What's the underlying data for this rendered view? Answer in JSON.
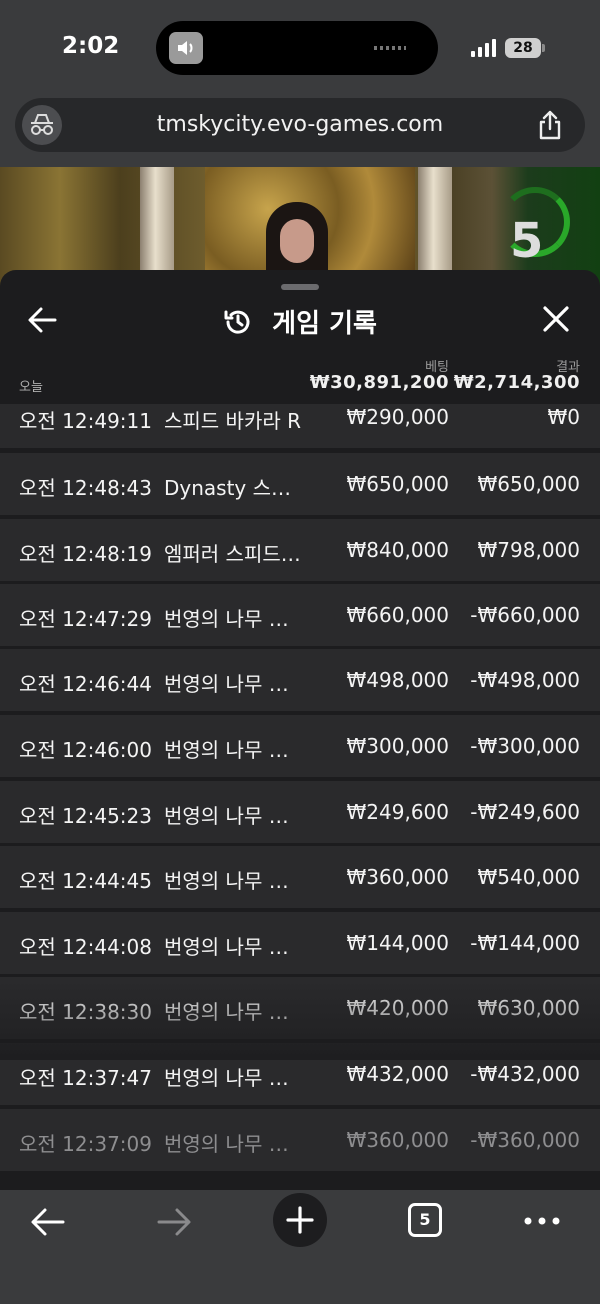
{
  "status_bar": {
    "time": "2:02",
    "battery": "28"
  },
  "browser": {
    "url": "tmskycity.evo-games.com",
    "tab_count": "5"
  },
  "video": {
    "timer": "5"
  },
  "panel": {
    "title": "게임 기록",
    "section_label": "오늘",
    "bet_header": "베팅",
    "result_header": "결과",
    "bet_total": "₩30,891,200",
    "result_total": "₩2,714,300",
    "rows": [
      {
        "time": "오전 12:49:11",
        "game": "스피드 바카라 R",
        "bet": "₩290,000",
        "result": "₩0"
      },
      {
        "time": "오전 12:48:43",
        "game": "Dynasty 스피...",
        "bet": "₩650,000",
        "result": "₩650,000"
      },
      {
        "time": "오전 12:48:19",
        "game": "엠퍼러 스피드 ...",
        "bet": "₩840,000",
        "result": "₩798,000"
      },
      {
        "time": "오전 12:47:29",
        "game": "번영의 나무 바...",
        "bet": "₩660,000",
        "result": "-₩660,000"
      },
      {
        "time": "오전 12:46:44",
        "game": "번영의 나무 바...",
        "bet": "₩498,000",
        "result": "-₩498,000"
      },
      {
        "time": "오전 12:46:00",
        "game": "번영의 나무 바...",
        "bet": "₩300,000",
        "result": "-₩300,000"
      },
      {
        "time": "오전 12:45:23",
        "game": "번영의 나무 바...",
        "bet": "₩249,600",
        "result": "-₩249,600"
      },
      {
        "time": "오전 12:44:45",
        "game": "번영의 나무 바...",
        "bet": "₩360,000",
        "result": "₩540,000"
      },
      {
        "time": "오전 12:44:08",
        "game": "번영의 나무 바...",
        "bet": "₩144,000",
        "result": "-₩144,000"
      },
      {
        "time": "오전 12:38:30",
        "game": "번영의 나무 바...",
        "bet": "₩420,000",
        "result": "₩630,000"
      },
      {
        "time": "오전 12:37:47",
        "game": "번영의 나무 바...",
        "bet": "₩432,000",
        "result": "-₩432,000"
      },
      {
        "time": "오전 12:37:09",
        "game": "번영의 나무 바...",
        "bet": "₩360,000",
        "result": "-₩360,000"
      }
    ]
  },
  "icons": {
    "back": "arrow-left-icon",
    "history": "history-icon",
    "close": "close-icon",
    "share": "share-icon",
    "incognito": "incognito-icon",
    "forward": "arrow-right-icon",
    "new_tab": "plus-icon",
    "more": "more-dots-icon"
  }
}
